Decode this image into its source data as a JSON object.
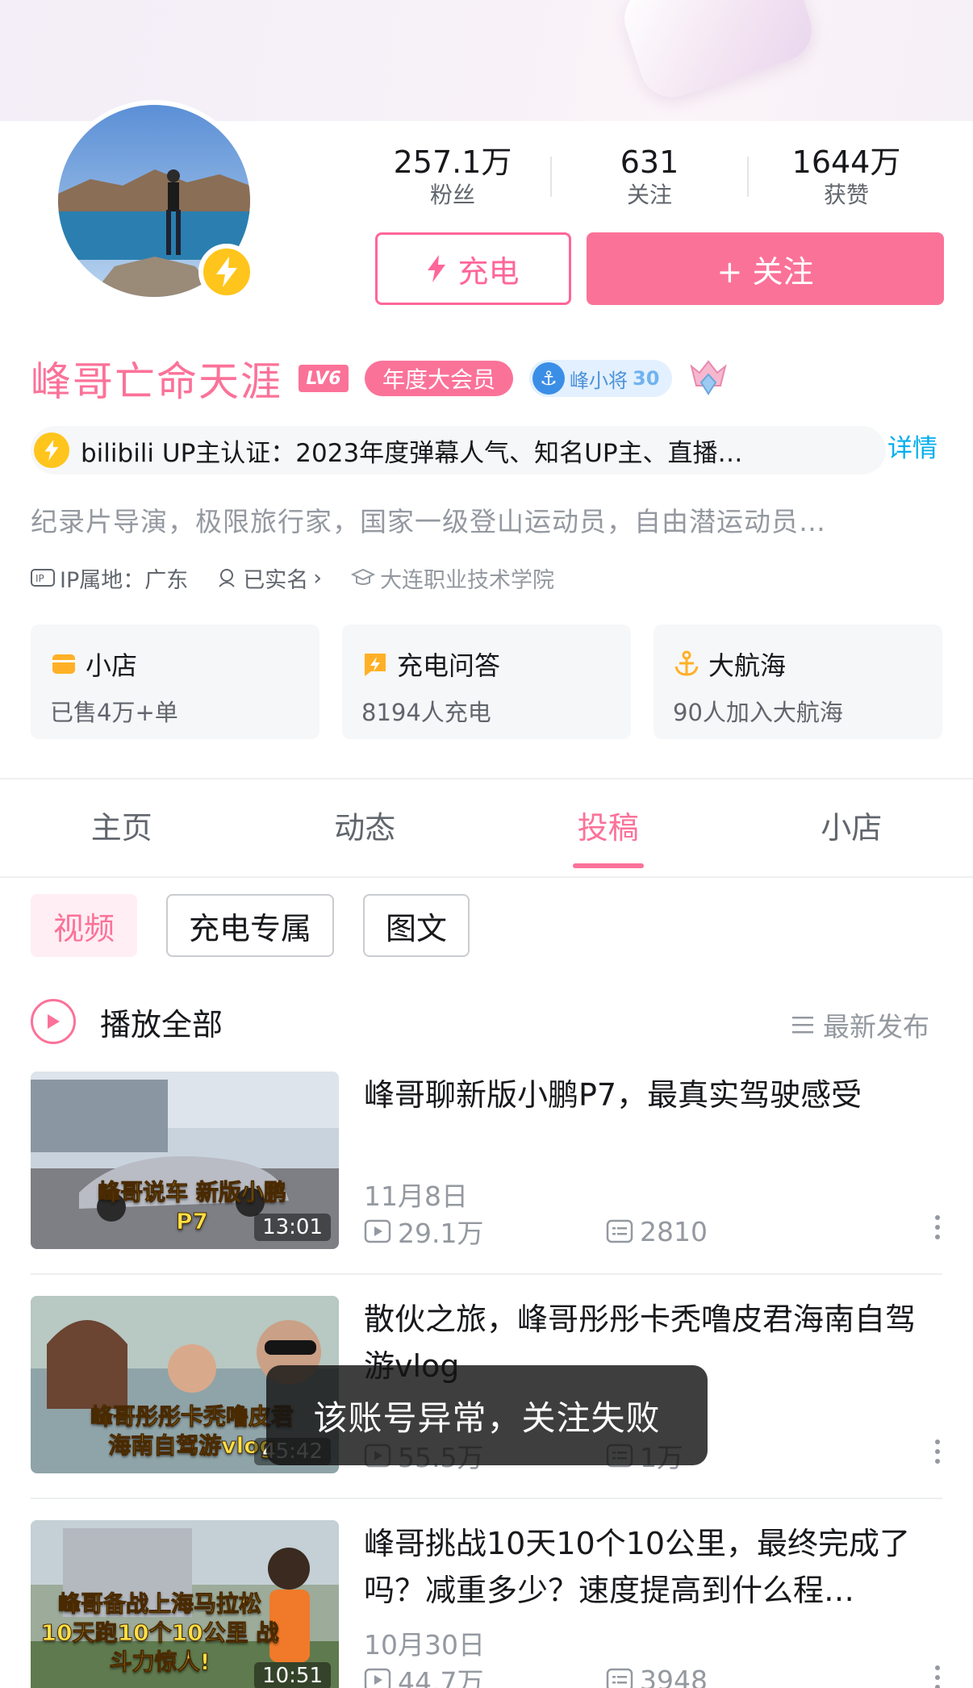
{
  "profile": {
    "stats": [
      {
        "value": "257.1万",
        "label": "粉丝"
      },
      {
        "value": "631",
        "label": "关注"
      },
      {
        "value": "1644万",
        "label": "获赞"
      }
    ],
    "charge_label": "充电",
    "follow_label": "+ 关注",
    "name": "峰哥亡命天涯",
    "level": "LV6",
    "vip_label": "年度大会员",
    "fans_medal_name": "峰小将",
    "fans_medal_level": "30",
    "verify_text": "bilibili UP主认证：2023年度弹幕人气、知名UP主、直播…",
    "detail_label": "详情",
    "bio": "纪录片导演，极限旅行家，国家一级登山运动员，自由潜运动员…",
    "ip_label": "IP属地：广东",
    "realname_label": "已实名",
    "school_label": "大连职业技术学院"
  },
  "cards": [
    {
      "title": "小店",
      "sub": "已售4万+单",
      "icon": "shop-icon",
      "color": "#ffb027"
    },
    {
      "title": "充电问答",
      "sub": "8194人充电",
      "icon": "charge-qa-icon",
      "color": "#ffb027"
    },
    {
      "title": "大航海",
      "sub": "90人加入大航海",
      "icon": "anchor-icon",
      "color": "#ffb027"
    }
  ],
  "tabs": [
    {
      "label": "主页",
      "active": false
    },
    {
      "label": "动态",
      "active": false
    },
    {
      "label": "投稿",
      "active": true
    },
    {
      "label": "小店",
      "active": false
    }
  ],
  "chips": [
    {
      "label": "视频",
      "active": true
    },
    {
      "label": "充电专属",
      "active": false
    },
    {
      "label": "图文",
      "active": false
    }
  ],
  "list": {
    "play_all_label": "播放全部",
    "sort_label": "最新发布"
  },
  "videos": [
    {
      "title": "峰哥聊新版小鹏P7，最真实驾驶感受",
      "date": "11月8日",
      "views": "29.1万",
      "comments": "2810",
      "duration": "13:01",
      "caption": "峰哥说车 新版小鹏P7"
    },
    {
      "title": "散伙之旅，峰哥彤彤卡秃噜皮君海南自驾游vlog",
      "date": "",
      "views": "55.5万",
      "comments": "1万",
      "duration": "45:42",
      "caption": "峰哥彤彤卡秃噜皮君 海南自驾游vlog"
    },
    {
      "title": "峰哥挑战10天10个10公里，最终完成了吗？减重多少？速度提高到什么程…",
      "date": "10月30日",
      "views": "44.7万",
      "comments": "3948",
      "duration": "10:51",
      "caption": "峰哥备战上海马拉松 10天跑10个10公里 战斗力惊人!"
    }
  ],
  "toast": "该账号异常，关注失败",
  "colors": {
    "accent": "#fb7299",
    "link": "#00aeec",
    "gold": "#ffc51c"
  }
}
